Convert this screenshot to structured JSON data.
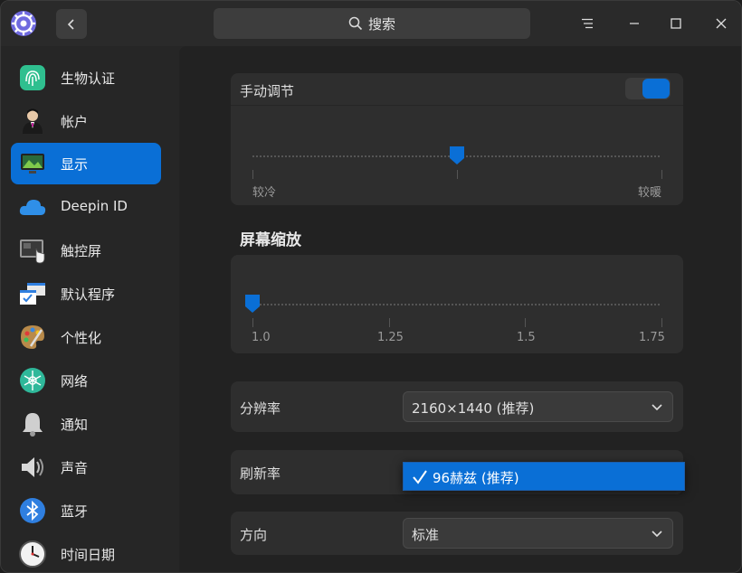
{
  "search": {
    "label": "搜索"
  },
  "sidebar": {
    "items": [
      {
        "label": "生物认证",
        "icon": "fingerprint-icon"
      },
      {
        "label": "帐户",
        "icon": "account-icon"
      },
      {
        "label": "显示",
        "icon": "display-icon",
        "active": true
      },
      {
        "label": "Deepin ID",
        "icon": "cloud-icon"
      },
      {
        "label": "触控屏",
        "icon": "touchscreen-icon"
      },
      {
        "label": "默认程序",
        "icon": "default-apps-icon"
      },
      {
        "label": "个性化",
        "icon": "palette-icon"
      },
      {
        "label": "网络",
        "icon": "network-icon"
      },
      {
        "label": "通知",
        "icon": "bell-icon"
      },
      {
        "label": "声音",
        "icon": "speaker-icon"
      },
      {
        "label": "蓝牙",
        "icon": "bluetooth-icon"
      },
      {
        "label": "时间日期",
        "icon": "clock-icon"
      }
    ]
  },
  "color_temp": {
    "title": "手动调节",
    "toggle_on": true,
    "slider_value": 0.5,
    "min_label": "较冷",
    "max_label": "较暖"
  },
  "scaling": {
    "title": "屏幕缩放",
    "ticks": [
      "1.0",
      "1.25",
      "1.5",
      "1.75"
    ],
    "selected": "1.0"
  },
  "resolution": {
    "label": "分辨率",
    "value": "2160×1440 (推荐)"
  },
  "refresh": {
    "label": "刷新率",
    "dropdown_option": "96赫兹 (推荐)"
  },
  "orientation": {
    "label": "方向",
    "value": "标准"
  },
  "colors": {
    "accent": "#0a6fd6",
    "background": "#262626",
    "panel": "#2e2e2e"
  }
}
